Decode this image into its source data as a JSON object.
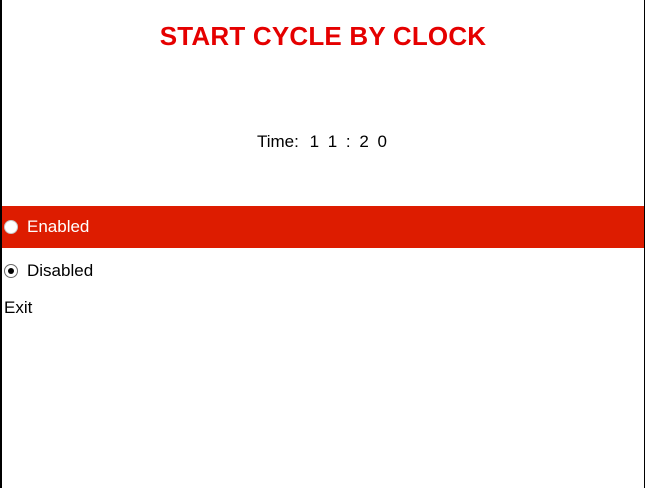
{
  "window": {
    "title": "START CYCLE BY CLOCK"
  },
  "time": {
    "label": "Time:",
    "value": "1 1 :  2 0"
  },
  "options": [
    {
      "label": "Enabled",
      "checked": false,
      "highlighted": true
    },
    {
      "label": "Disabled",
      "checked": true,
      "highlighted": false
    }
  ],
  "exit": {
    "label": "Exit"
  },
  "colors": {
    "title": "#e50000",
    "highlight_bg": "#dd1c00",
    "highlight_text": "#ffffff",
    "text": "#000000",
    "background": "#ffffff"
  },
  "icons": {
    "enabled_radio": "radio-unchecked-icon",
    "disabled_radio": "radio-checked-icon"
  }
}
